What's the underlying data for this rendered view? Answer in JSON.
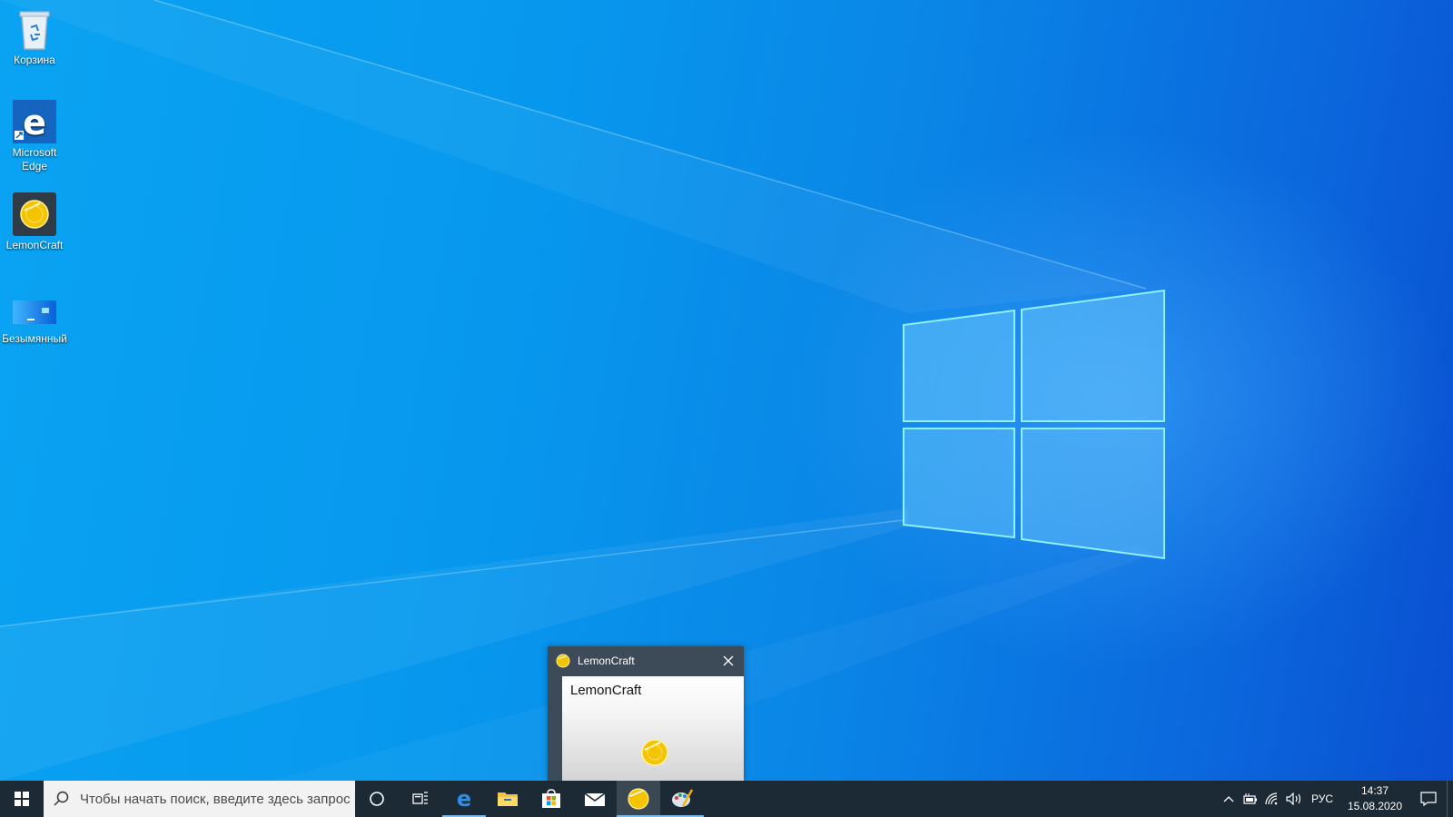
{
  "desktop": {
    "icons": [
      {
        "label": "Корзина",
        "icon": "recycle-bin-icon"
      },
      {
        "label": "Microsoft Edge",
        "icon": "edge-icon"
      },
      {
        "label": "LemonCraft",
        "icon": "lemon-icon"
      },
      {
        "label": "Безымянный",
        "icon": "image-file-icon"
      }
    ]
  },
  "window": {
    "title": "LemonCraft",
    "content_label": "LemonCraft",
    "title_icon": "lemon-icon",
    "close_icon": "close-icon"
  },
  "taskbar": {
    "search_placeholder": "Чтобы начать поиск, введите здесь запрос",
    "apps": [
      {
        "name": "edge",
        "icon": "edge-icon",
        "open": true
      },
      {
        "name": "file-explorer",
        "icon": "folder-icon",
        "open": false
      },
      {
        "name": "store",
        "icon": "store-icon",
        "open": false
      },
      {
        "name": "mail",
        "icon": "mail-icon",
        "open": false
      },
      {
        "name": "lemoncraft",
        "icon": "lemon-icon",
        "active": true
      },
      {
        "name": "paint",
        "icon": "paint-icon",
        "open": true
      }
    ],
    "tray": {
      "language": "РУС",
      "time": "14:37",
      "date": "15.08.2020"
    }
  },
  "colors": {
    "taskbar": "#1c2a35",
    "window_frame": "#3d4a57",
    "accent_underline": "#76b9ed",
    "lemon": "#f5c400"
  }
}
